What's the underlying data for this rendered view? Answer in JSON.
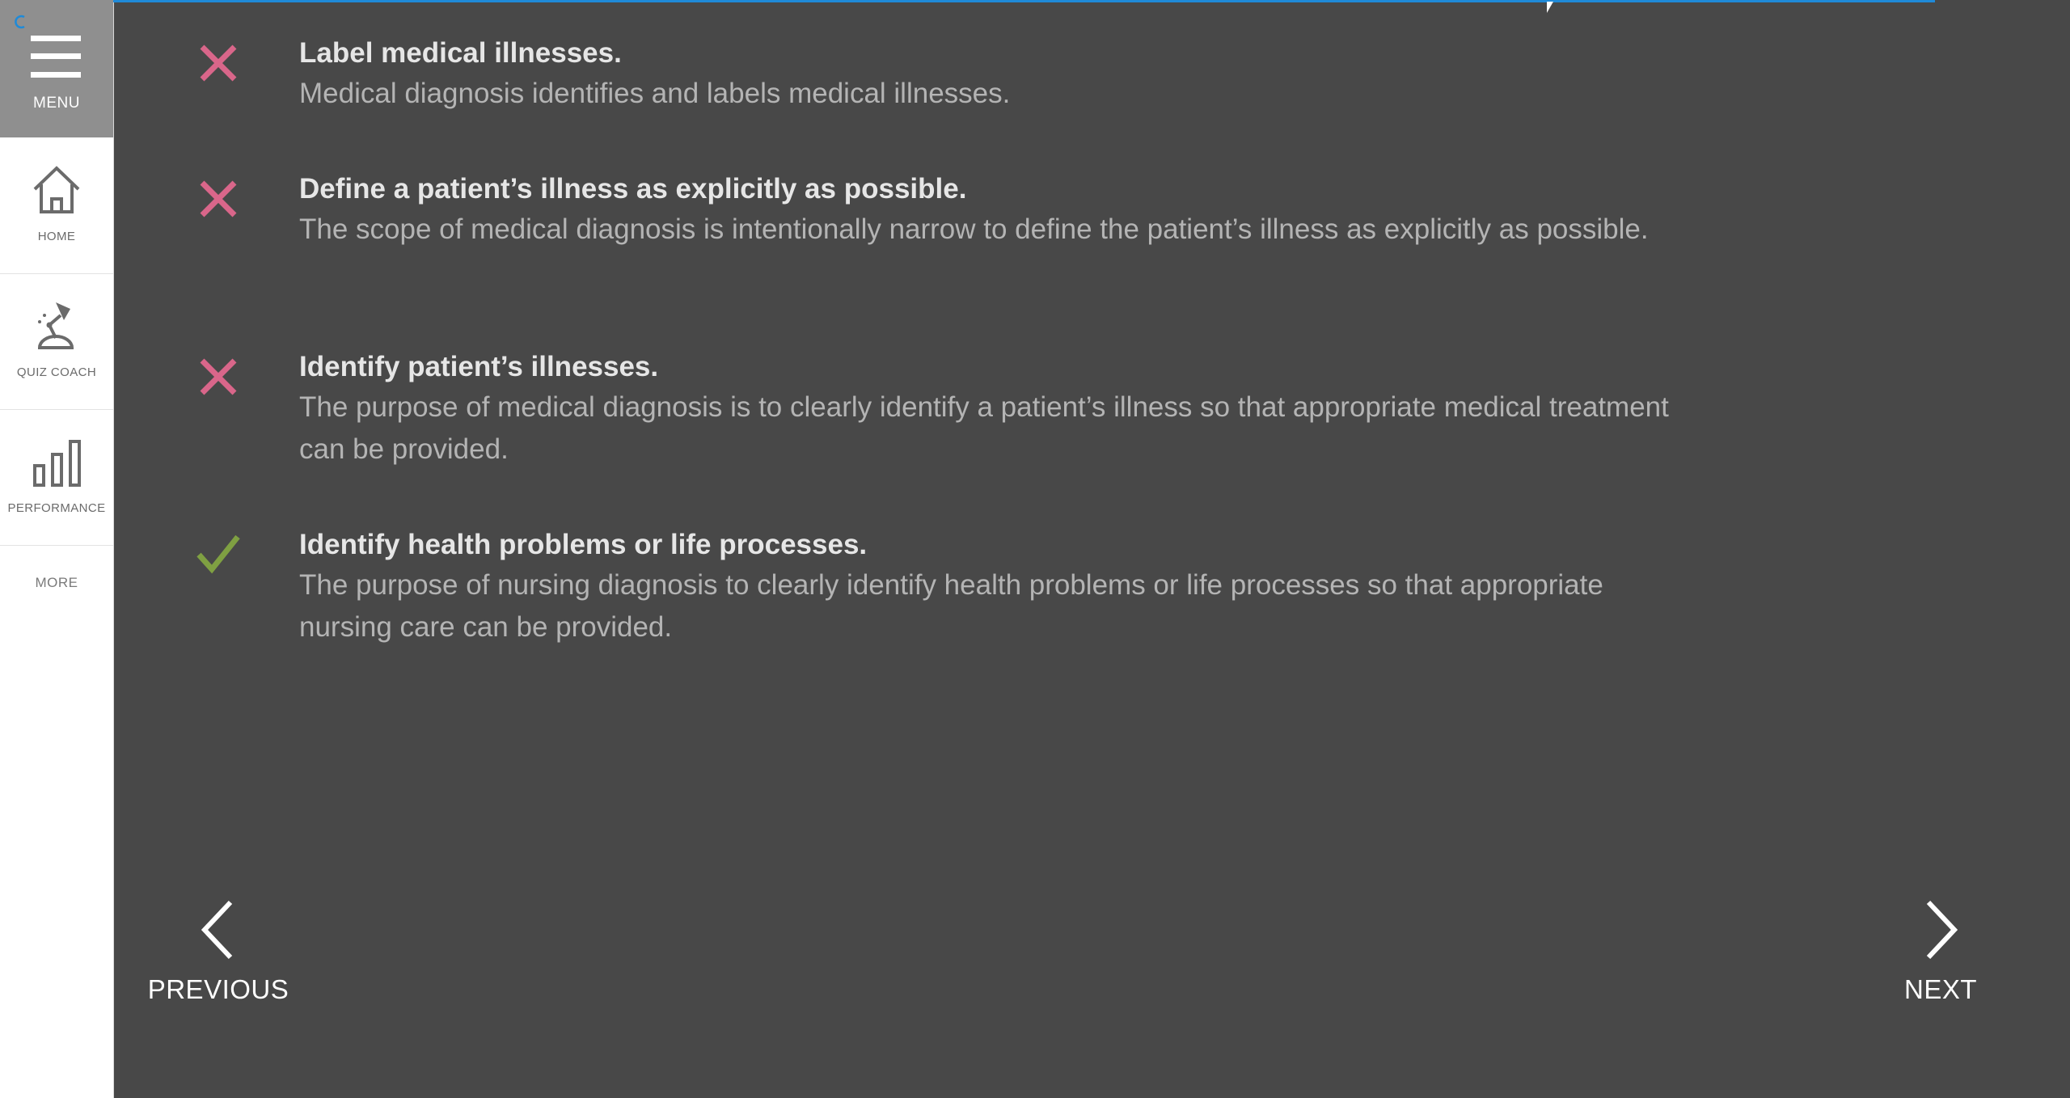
{
  "sidebar": {
    "menu_label": "MENU",
    "items": [
      {
        "label": "HOME",
        "icon": "home-icon"
      },
      {
        "label": "QUIZ COACH",
        "icon": "desk-lamp-icon"
      },
      {
        "label": "PERFORMANCE",
        "icon": "bar-chart-icon"
      }
    ],
    "more_label": "MORE"
  },
  "progress": {
    "value_percent": 100
  },
  "colors": {
    "incorrect": "#d9668a",
    "correct": "#7fa042",
    "accent": "#1f8ad8"
  },
  "options": [
    {
      "status": "incorrect",
      "icon": "x-icon",
      "title": "Label medical illnesses.",
      "description": "Medical diagnosis identifies and labels medical illnesses."
    },
    {
      "status": "incorrect",
      "icon": "x-icon",
      "title": "Define a patient’s illness as explicitly as possible.",
      "description": "The scope of medical diagnosis is intentionally narrow to define the patient’s illness as explicitly as possible."
    },
    {
      "status": "incorrect",
      "icon": "x-icon",
      "title": "Identify patient’s illnesses.",
      "description": "The purpose of medical diagnosis is to clearly identify a patient’s illness so that appropriate medical treatment can be provided."
    },
    {
      "status": "correct",
      "icon": "check-icon",
      "title": "Identify health problems or life processes.",
      "description": "The purpose of nursing diagnosis to clearly identify health problems or life processes so that appropriate nursing care can be provided."
    }
  ],
  "navigation": {
    "previous_label": "PREVIOUS",
    "next_label": "NEXT"
  }
}
